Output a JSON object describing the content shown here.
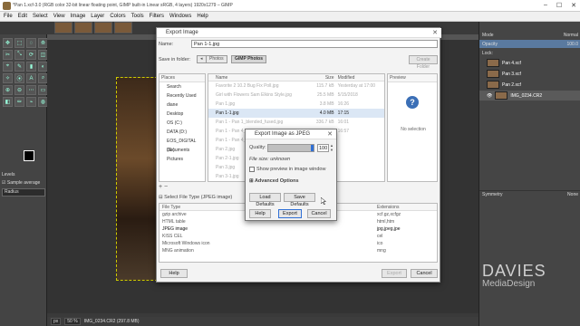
{
  "window": {
    "title": "*Pan 1.xcf-3.0 (RGB color 32-bit linear floating point, GIMP built-in Linear sRGB, 4 layers) 1920x1279 – GIMP",
    "controls": [
      "–",
      "☐",
      "✕"
    ]
  },
  "menu": [
    "File",
    "Edit",
    "Select",
    "View",
    "Image",
    "Layer",
    "Colors",
    "Tools",
    "Filters",
    "Windows",
    "Help"
  ],
  "tools": [
    "✥",
    "⬚",
    "◌",
    "⟰",
    "✂",
    "⤡",
    "⟳",
    "◫",
    "⌖",
    "✎",
    "▮",
    "◐",
    "✧",
    "⦿",
    "A",
    "⌕",
    "⊕",
    "⊖",
    "⋯",
    "▭",
    "◧",
    "✏",
    "⌁",
    "◍"
  ],
  "tool_options": {
    "title": "Levels",
    "sample_average_label": "Sample average",
    "radius_label": "Radius"
  },
  "statusbar": {
    "unit": "px",
    "zoom": "50 %",
    "info": "IMG_0234.CR2 (297.8 MB)"
  },
  "right_dock": {
    "mode_label": "Mode",
    "mode_value": "Normal",
    "opacity_label": "Opacity",
    "opacity_value": "100.0",
    "lock_label": "Lock:",
    "layers": [
      "Pan 4.xcf",
      "Pan 3.xcf",
      "Pan 2.xcf",
      "IMG_0234.CR2"
    ],
    "symmetry_label": "Symmetry",
    "symmetry_value": "None"
  },
  "watermark": {
    "line1": "DAVIES",
    "line2": "MediaDesign"
  },
  "export_dialog": {
    "title": "Export Image",
    "name_label": "Name:",
    "name_value": "Pan 1-1.jpg",
    "save_in_label": "Save in folder:",
    "crumbs": [
      "◂",
      "Photos",
      "GIMP Photos"
    ],
    "create_folder": "Create Folder",
    "places_header": "Places",
    "places": [
      "Search",
      "Recently Used",
      "diane",
      "Desktop",
      "OS (C:)",
      "DATA (D:)",
      "EOS_DIGITAL (G:)",
      "Documents",
      "Pictures"
    ],
    "files_headers": {
      "name": "Name",
      "size": "Size",
      "modified": "Modified"
    },
    "files": [
      {
        "name": "Favorite 2 10.2 Bug Fix Poll.jpg",
        "size": "115.7 kB",
        "modified": "Yesterday at 17:00"
      },
      {
        "name": "Girl with Flowers Sam Elkins Style.jpg",
        "size": "25.5 MB",
        "modified": "5/15/2018"
      },
      {
        "name": "Pan 1.jpg",
        "size": "3.8 MB",
        "modified": "16:26"
      },
      {
        "name": "Pan 1-1.jpg",
        "size": "4.0 MB",
        "modified": "17:15"
      },
      {
        "name": "Pan 1 - Pan 1_blended_fused.jpg",
        "size": "336.7 kB",
        "modified": "16:01"
      },
      {
        "name": "Pan 1 - Pan 4_blended_fused.jpg",
        "size": "854.3 kB",
        "modified": "16:57"
      },
      {
        "name": "Pan 1 - Pan 4_blended_fused.jpg",
        "size": "",
        "modified": ""
      },
      {
        "name": "Pan 2.jpg",
        "size": "",
        "modified": ""
      },
      {
        "name": "Pan 2-1.jpg",
        "size": "",
        "modified": ""
      },
      {
        "name": "Pan 3.jpg",
        "size": "",
        "modified": ""
      },
      {
        "name": "Pan 3-1.jpg",
        "size": "",
        "modified": ""
      }
    ],
    "preview_header": "Preview",
    "no_selection": "No selection",
    "select_file_type": "Select File Type (JPEG image)",
    "types_headers": {
      "name": "File Type",
      "ext": "Extensions"
    },
    "types": [
      {
        "name": "gzip archive",
        "ext": "xcf.gz,xcfgz"
      },
      {
        "name": "HTML table",
        "ext": "html,htm"
      },
      {
        "name": "JPEG image",
        "ext": "jpg,jpeg,jpe"
      },
      {
        "name": "KISS CEL",
        "ext": "cel"
      },
      {
        "name": "Microsoft Windows icon",
        "ext": "ico"
      },
      {
        "name": "MNG animation",
        "ext": "mng"
      }
    ],
    "help": "Help",
    "export": "Export",
    "cancel": "Cancel"
  },
  "jpeg_dialog": {
    "title": "Export Image as JPEG",
    "quality_label": "Quality:",
    "quality_value": "100",
    "quality_fraction": 1.0,
    "file_size": "File size: unknown",
    "show_preview": "Show preview in image window",
    "advanced": "Advanced Options",
    "load_defaults": "Load Defaults",
    "save_defaults": "Save Defaults",
    "help": "Help",
    "export": "Export",
    "cancel": "Cancel"
  },
  "colors": {
    "selection_blue": "#2f6fd6",
    "row_highlight": "#dbe7f5"
  }
}
